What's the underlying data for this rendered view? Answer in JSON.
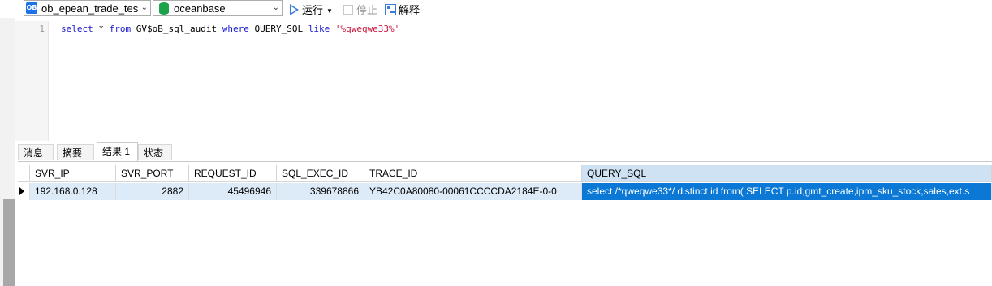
{
  "toolbar": {
    "connection_icon_text": "OB",
    "connection_value": "ob_epean_trade_tes",
    "database_value": "oceanbase",
    "run_label": "运行",
    "stop_label": "停止",
    "explain_label": "解释"
  },
  "editor": {
    "line_number": "1",
    "query_parts": {
      "kw_select": "select",
      "star": " * ",
      "kw_from": "from",
      "table": " GV$oB_sql_audit ",
      "kw_where": "where",
      "column": " QUERY_SQL ",
      "kw_like": "like",
      "space": " ",
      "pattern": "'%qweqwe33%'"
    }
  },
  "result_tabs": [
    "消息",
    "摘要",
    "结果 1",
    "状态"
  ],
  "grid": {
    "columns": [
      "SVR_IP",
      "SVR_PORT",
      "REQUEST_ID",
      "SQL_EXEC_ID",
      "TRACE_ID",
      "QUERY_SQL"
    ],
    "rows": [
      [
        "192.168.0.128",
        "2882",
        "45496946",
        "339678866",
        "YB42C0A80080-00061CCCCDA2184E-0-0",
        "select /*qweqwe33*/ distinct id from( SELECT p.id,gmt_create,ipm_sku_stock,sales,ext.s"
      ]
    ]
  },
  "colors": {
    "accent": "#0a78d4",
    "keyword": "#1a1acc",
    "string": "#c8143c",
    "row_bg": "#ddeaf7"
  }
}
